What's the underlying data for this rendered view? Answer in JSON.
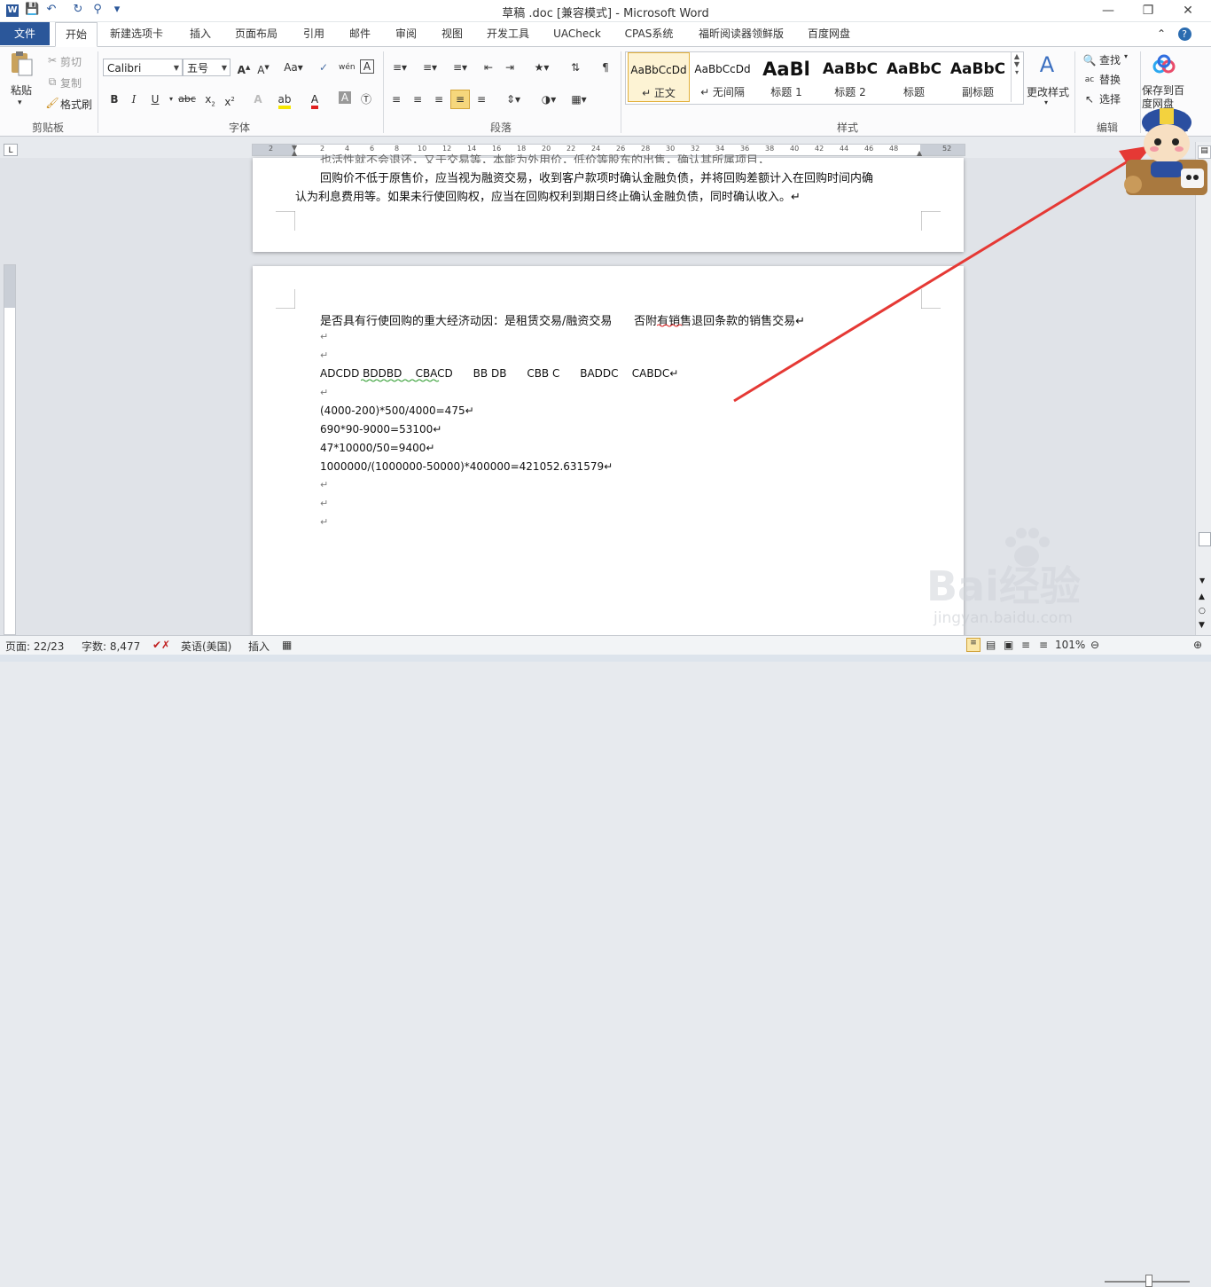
{
  "window": {
    "title": "草稿 .doc [兼容模式] - Microsoft Word",
    "controls": [
      "minimize",
      "restore",
      "close"
    ]
  },
  "tabs": [
    "文件",
    "开始",
    "新建选项卡",
    "插入",
    "页面布局",
    "引用",
    "邮件",
    "审阅",
    "视图",
    "开发工具",
    "UACheck",
    "CPAS系统",
    "福昕阅读器领鲜版",
    "百度网盘"
  ],
  "active_tab": "开始",
  "clipboard": {
    "paste_label": "粘贴",
    "cut_label": "剪切",
    "copy_label": "复制",
    "format_painter_label": "格式刷",
    "group_label": "剪贴板"
  },
  "font": {
    "family_value": "Calibri",
    "size_value": "五号",
    "group_label": "字体"
  },
  "paragraph": {
    "group_label": "段落"
  },
  "styles": {
    "items": [
      {
        "preview": "AaBbCcDd",
        "name": "↵ 正文",
        "selected": true
      },
      {
        "preview": "AaBbCcDd",
        "name": "↵ 无间隔"
      },
      {
        "preview": "AaBl",
        "name": "标题 1"
      },
      {
        "preview": "AaBbC",
        "name": "标题 2"
      },
      {
        "preview": "AaBbC",
        "name": "标题"
      },
      {
        "preview": "AaBbC",
        "name": "副标题"
      }
    ],
    "change_styles_label": "更改样式",
    "group_label": "样式"
  },
  "editing": {
    "find_label": "查找",
    "replace_label": "替换",
    "select_label": "选择",
    "group_label": "编辑"
  },
  "baidu": {
    "save_label": "保存到百度网盘"
  },
  "ruler": {
    "numbers": [
      "2",
      "2",
      "4",
      "6",
      "8",
      "10",
      "12",
      "14",
      "16",
      "18",
      "20",
      "22",
      "24",
      "26",
      "28",
      "30",
      "32",
      "34",
      "36",
      "38",
      "40",
      "42",
      "44",
      "46",
      "48",
      "52"
    ]
  },
  "page1": {
    "partial_top": "也活性就不会退还，又于交易等，本能为外用价，低价等股东的出售，确认其所属项目，",
    "line1": "回购价不低于原售价，应当视为融资交易，收到客户款项时确认金融负债，并将回购差额计入在回购时间内确",
    "line2": "认为利息费用等。如果未行使回购权，应当在回购权利到期日终止确认金融负债，同时确认收入。↵"
  },
  "page2": {
    "lines": [
      "是否具有行使回购的重大经济动因：是租赁交易/融资交易      否附有销售退回条款的销售交易↵",
      "↵",
      "↵",
      "ADCDD BDDBD    CBACD      BB DB      CBB C      BADDC    CABDC↵",
      "↵",
      "(4000-200)*500/4000=475↵",
      "690*90-9000=53100↵",
      "47*10000/50=9400↵",
      "1000000/(1000000-50000)*400000=421052.631579↵",
      "↵",
      "↵",
      "↵"
    ]
  },
  "status": {
    "page": "页面: 22/23",
    "words": "字数: 8,477",
    "language": "英语(美国)",
    "mode": "插入",
    "zoom": "101%"
  },
  "watermark": {
    "brand": "Bai经验",
    "url": "jingyan.baidu.com"
  },
  "overlay": {
    "arrow_color": "#e53935"
  }
}
